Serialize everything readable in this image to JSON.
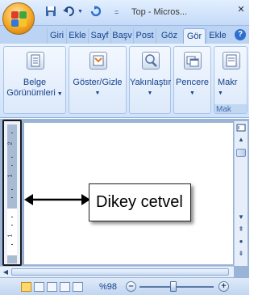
{
  "window": {
    "title": "Top - Micros...",
    "controls": {
      "minimize": "–",
      "restore": "□",
      "close": "✕"
    }
  },
  "quick_access": {
    "save_icon": "save-icon",
    "undo_icon": "undo-icon",
    "redo_icon": "redo-icon",
    "customize_icon": "customize-icon"
  },
  "tabs": [
    {
      "label": "Giri"
    },
    {
      "label": "Ekle"
    },
    {
      "label": "Sayf"
    },
    {
      "label": "Başv"
    },
    {
      "label": "Post"
    },
    {
      "label": "Göz"
    },
    {
      "label": "Gör",
      "active": true
    },
    {
      "label": "Ekle"
    }
  ],
  "ribbon": {
    "groups": [
      {
        "label_line1": "Belge",
        "label_line2": "Görünümleri",
        "icon": "document-views-icon"
      },
      {
        "label_line1": "Göster/Gizle",
        "icon": "show-hide-icon"
      },
      {
        "label_line1": "Yakınlaştır",
        "icon": "zoom-icon"
      },
      {
        "label_line1": "Pencere",
        "icon": "window-icon"
      },
      {
        "label_line1": "Makr",
        "group_label": "Mak",
        "icon": "macro-icon"
      }
    ]
  },
  "ruler": {
    "numbers": [
      "2",
      "1",
      "1"
    ]
  },
  "status": {
    "zoom_level": "%98",
    "zoom_fraction": 0.46
  },
  "callout": {
    "text": "Dikey cetvel"
  },
  "colors": {
    "accent": "#15428b",
    "ribbon_bg": "#d1e2f8",
    "callout_border": "#222222"
  }
}
